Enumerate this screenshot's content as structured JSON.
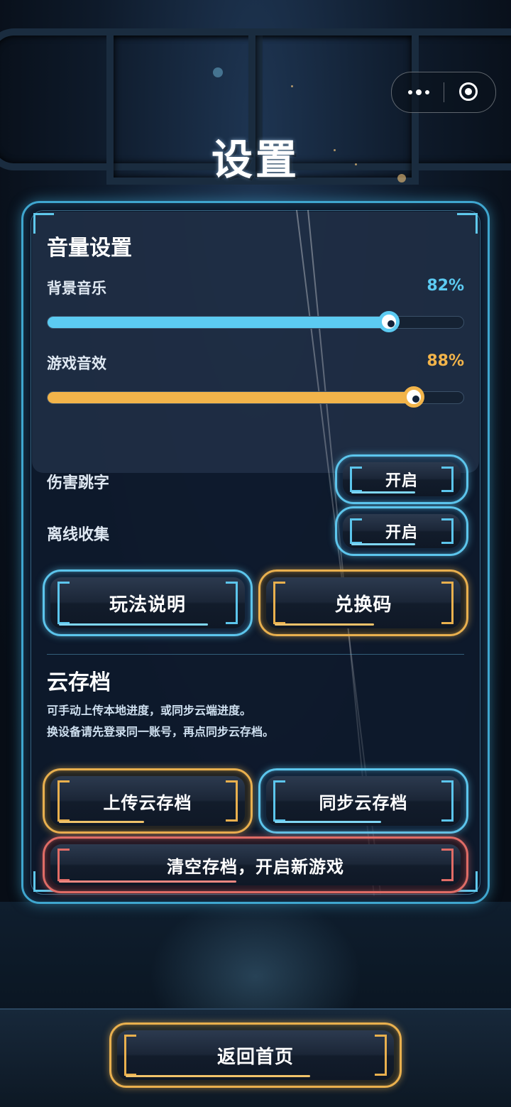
{
  "window": {
    "title": "设置"
  },
  "capsule": {
    "more_icon": "more-dots-icon",
    "close_icon": "target-circle-icon"
  },
  "volume": {
    "title": "音量设置",
    "music": {
      "label": "背景音乐",
      "value_text": "82%",
      "value": 0.82,
      "color": "#5ccbf2"
    },
    "sfx": {
      "label": "游戏音效",
      "value_text": "88%",
      "value": 0.88,
      "color": "#f2b44a"
    }
  },
  "toggles": [
    {
      "label": "伤害跳字",
      "state": "开启"
    },
    {
      "label": "离线收集",
      "state": "开启"
    }
  ],
  "actions": {
    "guide": "玩法说明",
    "redeem": "兑换码"
  },
  "cloud": {
    "title": "云存档",
    "desc1": "可手动上传本地进度，或同步云端进度。",
    "desc2": "换设备请先登录同一账号，再点同步云存档。",
    "upload": "上传云存档",
    "sync": "同步云存档",
    "reset": "清空存档，开启新游戏"
  },
  "home": {
    "label": "返回首页"
  },
  "colors": {
    "accent_blue": "#5cc5ec",
    "accent_gold": "#e9b04e",
    "danger": "#e06c66"
  }
}
